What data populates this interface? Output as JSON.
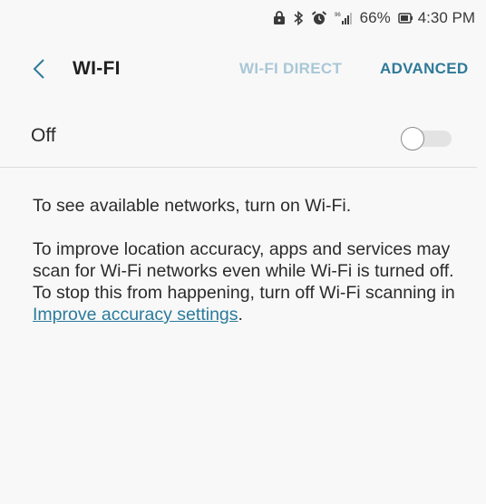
{
  "status_bar": {
    "icons": [
      "lock-icon",
      "bluetooth-icon",
      "alarm-icon",
      "signal-icon",
      "battery-icon"
    ],
    "battery": "66%",
    "time": "4:30 PM"
  },
  "header": {
    "title": "WI-FI",
    "tabs": [
      {
        "label": "WI-FI DIRECT",
        "enabled": false
      },
      {
        "label": "ADVANCED",
        "enabled": true
      }
    ]
  },
  "wifi_toggle": {
    "label": "Off",
    "state": false
  },
  "info": {
    "line1": "To see available networks, turn on Wi-Fi.",
    "paragraph2_text": "To improve location accuracy, apps and services may scan for Wi-Fi networks even while Wi-Fi is turned off. To stop this from happening, turn off Wi-Fi scanning in",
    "link_text": "Improve accuracy settings",
    "trailing": "."
  },
  "colors": {
    "background": "#f8f8f8",
    "accent": "#2f7a9a",
    "disabled_tab": "#a9c7d6",
    "link": "#2a7b9b"
  }
}
